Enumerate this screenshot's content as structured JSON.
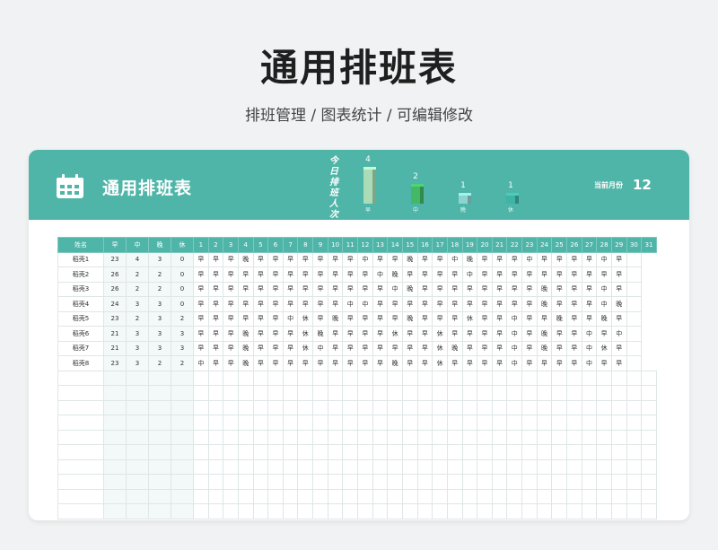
{
  "page": {
    "title": "通用排班表",
    "subtitle": "排班管理 / 图表统计 / 可编辑修改"
  },
  "card": {
    "title": "通用排班表",
    "chart_title": "今日排班人次",
    "month_label": "当前月份",
    "month_value": "12"
  },
  "chart_data": {
    "type": "bar",
    "title": "今日排班人次",
    "categories": [
      "早",
      "中",
      "晚",
      "休"
    ],
    "values": [
      4,
      2,
      1,
      1
    ],
    "colors": [
      "#a9dcb7",
      "#43b865",
      "#8dd3cf",
      "#3fb3a6"
    ],
    "ylim": [
      0,
      4
    ]
  },
  "colors": {
    "accent": "#4fb5a8",
    "background": "#f0f2f3"
  },
  "table": {
    "headers": [
      "姓名",
      "早",
      "中",
      "晚",
      "休",
      "1",
      "2",
      "3",
      "4",
      "5",
      "6",
      "7",
      "8",
      "9",
      "10",
      "11",
      "12",
      "13",
      "14",
      "15",
      "16",
      "17",
      "18",
      "19",
      "20",
      "21",
      "22",
      "23",
      "24",
      "25",
      "26",
      "27",
      "28",
      "29",
      "30",
      "31"
    ],
    "rows": [
      [
        "稻壳1",
        "23",
        "4",
        "3",
        "0",
        "早",
        "早",
        "早",
        "晚",
        "早",
        "早",
        "早",
        "早",
        "早",
        "早",
        "早",
        "中",
        "早",
        "早",
        "晚",
        "早",
        "早",
        "中",
        "晚",
        "早",
        "早",
        "早",
        "中",
        "早",
        "早",
        "早",
        "早",
        "中",
        "早",
        ""
      ],
      [
        "稻壳2",
        "26",
        "2",
        "2",
        "0",
        "早",
        "早",
        "早",
        "早",
        "早",
        "早",
        "早",
        "早",
        "早",
        "早",
        "早",
        "早",
        "中",
        "晚",
        "早",
        "早",
        "早",
        "早",
        "中",
        "早",
        "早",
        "早",
        "早",
        "早",
        "早",
        "早",
        "早",
        "早",
        "早",
        ""
      ],
      [
        "稻壳3",
        "26",
        "2",
        "2",
        "0",
        "早",
        "早",
        "早",
        "早",
        "早",
        "早",
        "早",
        "早",
        "早",
        "早",
        "早",
        "早",
        "早",
        "中",
        "晚",
        "早",
        "早",
        "早",
        "早",
        "早",
        "早",
        "早",
        "早",
        "晚",
        "早",
        "早",
        "早",
        "中",
        "早",
        ""
      ],
      [
        "稻壳4",
        "24",
        "3",
        "3",
        "0",
        "早",
        "早",
        "早",
        "早",
        "早",
        "早",
        "早",
        "早",
        "早",
        "早",
        "中",
        "中",
        "早",
        "早",
        "早",
        "早",
        "早",
        "早",
        "早",
        "早",
        "早",
        "早",
        "早",
        "晚",
        "早",
        "早",
        "早",
        "中",
        "晚",
        ""
      ],
      [
        "稻壳5",
        "23",
        "2",
        "3",
        "2",
        "早",
        "早",
        "早",
        "早",
        "早",
        "早",
        "中",
        "休",
        "早",
        "晚",
        "早",
        "早",
        "早",
        "早",
        "晚",
        "早",
        "早",
        "早",
        "休",
        "早",
        "早",
        "中",
        "早",
        "早",
        "晚",
        "早",
        "早",
        "晚",
        "早",
        ""
      ],
      [
        "稻壳6",
        "21",
        "3",
        "3",
        "3",
        "早",
        "早",
        "早",
        "晚",
        "早",
        "早",
        "早",
        "休",
        "晚",
        "早",
        "早",
        "早",
        "早",
        "休",
        "早",
        "早",
        "休",
        "早",
        "早",
        "早",
        "早",
        "中",
        "早",
        "晚",
        "早",
        "早",
        "中",
        "早",
        "中",
        ""
      ],
      [
        "稻壳7",
        "21",
        "3",
        "3",
        "3",
        "早",
        "早",
        "早",
        "晚",
        "早",
        "早",
        "早",
        "休",
        "中",
        "早",
        "早",
        "早",
        "早",
        "早",
        "早",
        "早",
        "休",
        "晚",
        "早",
        "早",
        "早",
        "中",
        "早",
        "晚",
        "早",
        "早",
        "中",
        "休",
        "早",
        ""
      ],
      [
        "稻壳8",
        "23",
        "3",
        "2",
        "2",
        "中",
        "早",
        "早",
        "晚",
        "早",
        "早",
        "早",
        "早",
        "早",
        "早",
        "早",
        "早",
        "早",
        "晚",
        "早",
        "早",
        "休",
        "早",
        "早",
        "早",
        "早",
        "中",
        "早",
        "早",
        "早",
        "早",
        "中",
        "早",
        "早",
        ""
      ]
    ],
    "empty_rows": 10
  }
}
